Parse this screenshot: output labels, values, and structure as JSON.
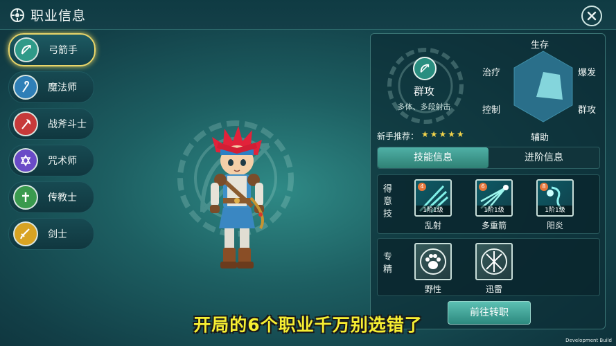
{
  "header": {
    "title": "职业信息"
  },
  "classes": [
    {
      "label": "弓箭手",
      "icon": "bow-icon",
      "color": "#2f9a89",
      "active": true
    },
    {
      "label": "魔法师",
      "icon": "staff-icon",
      "color": "#2f7fb7",
      "active": false
    },
    {
      "label": "战斧斗士",
      "icon": "axe-icon",
      "color": "#c73a3a",
      "active": false
    },
    {
      "label": "咒术师",
      "icon": "hexagram-icon",
      "color": "#6a4bc7",
      "active": false
    },
    {
      "label": "传教士",
      "icon": "cross-icon",
      "color": "#3a9a4e",
      "active": false
    },
    {
      "label": "剑士",
      "icon": "sword-icon",
      "color": "#d8a323",
      "active": false
    }
  ],
  "role": {
    "name": "群攻",
    "desc": "多体、多段射击",
    "recommend_label": "新手推荐：",
    "stars": "★★★★★",
    "star_rating": 5
  },
  "radar": {
    "labels": {
      "top": "生存",
      "upper_left": "治疗",
      "upper_right": "爆发",
      "lower_left": "控制",
      "lower_right": "群攻",
      "bottom": "辅助"
    }
  },
  "tabs": [
    {
      "label": "技能信息",
      "active": true
    },
    {
      "label": "进阶信息",
      "active": false
    }
  ],
  "skills_section": {
    "label": "得意技",
    "items": [
      {
        "name": "乱射",
        "level": "1阶1级",
        "num": "4"
      },
      {
        "name": "多重箭",
        "level": "1阶1级",
        "num": "6"
      },
      {
        "name": "阳炎",
        "level": "1阶1级",
        "num": "8"
      }
    ]
  },
  "spec_section": {
    "label": "专精",
    "items": [
      {
        "name": "野性",
        "icon": "paw-icon"
      },
      {
        "name": "迅雷",
        "icon": "arrows-icon"
      }
    ]
  },
  "go_button": "前往转职",
  "subtitle": "开局的6个职业千万别选错了",
  "dev_build": "Development Build"
}
